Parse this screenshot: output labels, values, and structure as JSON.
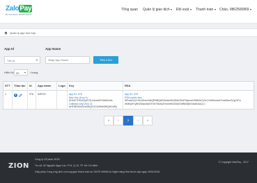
{
  "header": {
    "logo": {
      "primary": "Zalo",
      "accent": "Pay",
      "tagline": "BUSINESS MERCHANT"
    },
    "nav": [
      {
        "label": "Tổng quan",
        "dropdown": false
      },
      {
        "label": "Quản lý giao dịch",
        "dropdown": true
      },
      {
        "label": "Đối soát",
        "dropdown": true
      },
      {
        "label": "Thanh toán",
        "dropdown": true
      },
      {
        "label": "Chào, 0862500869",
        "dropdown": true
      }
    ]
  },
  "breadcrumb": {
    "icon": "home-icon",
    "text": "Quản lý app tích hợp"
  },
  "filters": {
    "app_id": {
      "label": "App Id",
      "value": "Tất cả"
    },
    "app_name": {
      "label": "App Name",
      "placeholder": "Nhập App Name"
    },
    "search_button": "TRA CỨU"
  },
  "page_size": {
    "prefix": "Hiển thị",
    "value": "30",
    "suffix": "/ trang"
  },
  "table": {
    "headers": [
      "STT",
      "Thao tác",
      "Id",
      "App name",
      "Logo",
      "Key",
      "RSA"
    ],
    "rows": [
      {
        "stt": "1",
        "id": "976",
        "app_name": "54POS",
        "logo": "",
        "key": {
          "app_id": "App ID: 976",
          "mac_key_label": "Mac Key (Key 1):",
          "mac_key": "0H4IC7HGtCZpfC3Lu3ceb5Y2k65vh4s",
          "callback_label": "Callback key (Key 2):",
          "callback_key": "aHF5E2kNOUm5hQC3Ck0HsK8RQbGbPp"
        },
        "rsa": {
          "app_id": "App ID: 976",
          "public_label": "RSA public key:",
          "public_key": "MFwwDQYJKoZIhvcNAQEBBQADSwAwSAJBAOSnP0jvmwHS8k0A7yXrCrSsRnodcbYwABsxOUgYrPo",
          "public_key_2": "9rMhp5Yy8HZ0aw4bd7t7l4YNUIkZH4nhW42l3dGh5RyWj0GAwEAAQ=="
        }
      }
    ]
  },
  "pagination": {
    "first": "«",
    "prev": "‹",
    "current": "1",
    "next": "›",
    "last": "»"
  },
  "footer": {
    "brand": "ZION",
    "company": "Công ty Cổ phần ZION",
    "address": "Trụ sở: 52 Nguyễn Ngọc Lộc, P.14, Q.10, TP. Hồ Chí Minh",
    "license": "Giấy phép Cung ứng dịch vụ trung gian thanh toán số 19/GP-NHNN do Ngân hàng Nhà Nước cấp ngày 18/01/2016",
    "copyright": "© Copyright ZaloPay - 2017"
  },
  "colors": {
    "brand_blue": "#2a9fd8",
    "brand_green": "#2ab24f",
    "link_blue": "#2a73c9",
    "footer_bg": "#2b2e33"
  }
}
